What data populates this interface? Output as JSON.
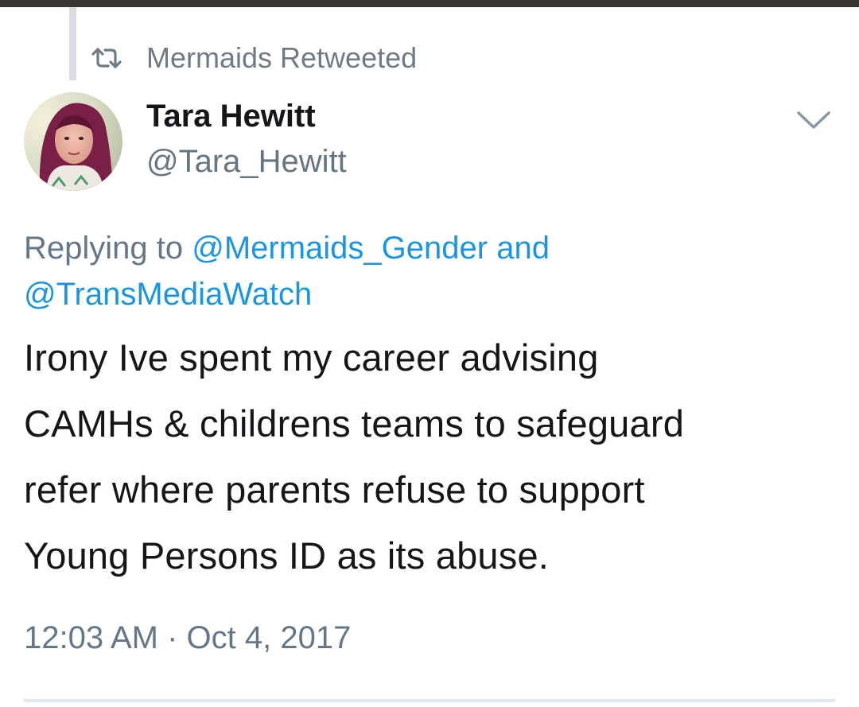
{
  "retweet_header": {
    "text": "Mermaids Retweeted",
    "icon": "retweet-icon"
  },
  "author": {
    "display_name": "Tara Hewitt",
    "handle": "@Tara_Hewitt",
    "avatar": "profile-photo"
  },
  "menu": {
    "icon": "chevron-down-icon"
  },
  "reply_context": {
    "prefix": "Replying to ",
    "mention_1": "@Mermaids_Gender",
    "conjunction": " and",
    "mention_2": "@TransMediaWatch"
  },
  "tweet": {
    "lines": [
      "Irony Ive spent my career advising",
      "CAMHs & childrens teams to safeguard",
      "refer where parents refuse to support",
      "Young Persons ID as its abuse."
    ]
  },
  "timestamp": "12:03 AM · Oct 4, 2017",
  "colors": {
    "link": "#1b95e0",
    "secondary_text": "#657786",
    "primary_text": "#14171a",
    "divider": "#e1e8ed"
  }
}
